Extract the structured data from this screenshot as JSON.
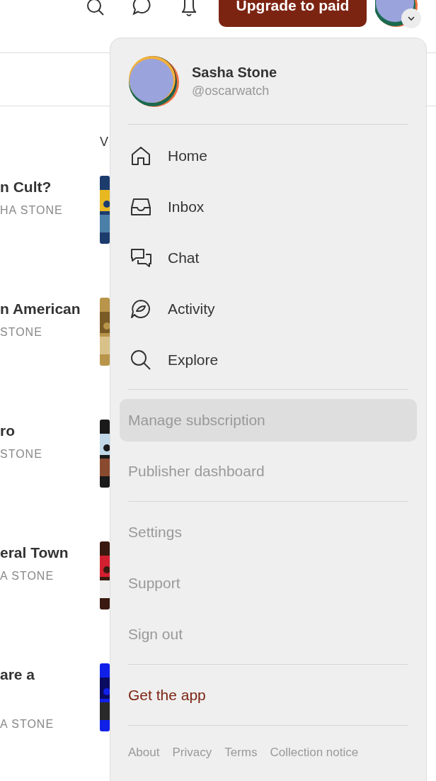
{
  "header": {
    "upgrade_button": "Upgrade to paid"
  },
  "column_heading": "V",
  "articles": [
    {
      "title": "n Cult?",
      "author": "HA STONE"
    },
    {
      "title": "n American",
      "author": "STONE"
    },
    {
      "title": "ro",
      "author": "STONE"
    },
    {
      "title": "eral Town",
      "author": "A STONE"
    },
    {
      "title": "are a",
      "author": "A STONE"
    }
  ],
  "menu": {
    "user": {
      "name": "Sasha Stone",
      "handle": "@oscarwatch"
    },
    "sections": [
      {
        "items": [
          {
            "kind": "nav",
            "label": "Home",
            "selected": false
          },
          {
            "kind": "nav",
            "label": "Inbox",
            "selected": false
          },
          {
            "kind": "nav",
            "label": "Chat",
            "selected": false
          },
          {
            "kind": "nav",
            "label": "Activity",
            "selected": false
          },
          {
            "kind": "nav",
            "label": "Explore",
            "selected": false
          }
        ]
      },
      {
        "items": [
          {
            "kind": "link",
            "label": "Manage subscription",
            "selected": true
          },
          {
            "kind": "link",
            "label": "Publisher dashboard",
            "selected": false
          }
        ]
      },
      {
        "items": [
          {
            "kind": "link",
            "label": "Settings",
            "selected": false
          },
          {
            "kind": "link",
            "label": "Support",
            "selected": false
          },
          {
            "kind": "link",
            "label": "Sign out",
            "selected": false
          }
        ]
      },
      {
        "items": [
          {
            "kind": "promo",
            "label": "Get the app",
            "selected": false
          }
        ]
      }
    ],
    "footer_links": [
      "About",
      "Privacy",
      "Terms",
      "Collection notice"
    ]
  }
}
